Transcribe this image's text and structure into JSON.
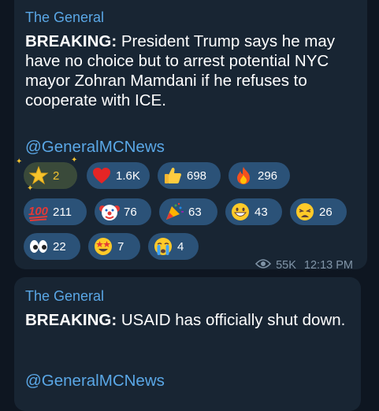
{
  "messages": [
    {
      "author": "The General",
      "text_bold": "BREAKING:",
      "text_rest": " President Trump says he may have no choice but to arrest potential NYC mayor Zohran Mamdani if he refuses to cooperate with ICE.",
      "link": "@GeneralMCNews",
      "reactions": [
        {
          "icon": "star-emoji",
          "count": "2"
        },
        {
          "icon": "heart-emoji",
          "count": "1.6K"
        },
        {
          "icon": "thumbs-up-emoji",
          "count": "698"
        },
        {
          "icon": "fire-emoji",
          "count": "296"
        },
        {
          "icon": "hundred-points-emoji",
          "count": "211"
        },
        {
          "icon": "clown-face-emoji",
          "count": "76"
        },
        {
          "icon": "party-popper-emoji",
          "count": "63"
        },
        {
          "icon": "grinning-face-emoji",
          "count": "43"
        },
        {
          "icon": "weary-face-emoji",
          "count": "26"
        },
        {
          "icon": "eyes-emoji",
          "count": "22"
        },
        {
          "icon": "star-struck-emoji",
          "count": "7"
        },
        {
          "icon": "crying-face-emoji",
          "count": "4"
        }
      ],
      "views": "55K",
      "time": "12:13 PM"
    },
    {
      "author": "The General",
      "text_bold": "BREAKING:",
      "text_rest": " USAID has officially shut down.",
      "link": "@GeneralMCNews"
    }
  ],
  "colors": {
    "background": "#0e1621",
    "bubble": "#182533",
    "accent": "#5aa7e6",
    "reaction_bg": "#2b5278",
    "meta": "#8195a8"
  }
}
